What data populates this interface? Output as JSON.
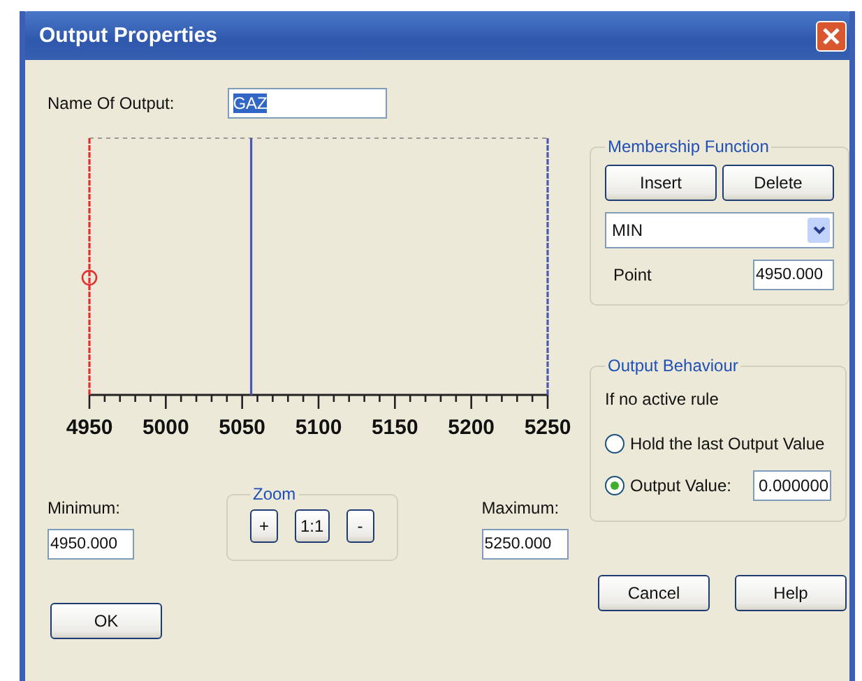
{
  "window": {
    "title": "Output Properties"
  },
  "name_field": {
    "label": "Name Of Output:",
    "value": "GAZ",
    "text_selected": true
  },
  "plot": {
    "axis_labels": [
      "4950",
      "5000",
      "5050",
      "5100",
      "5150",
      "5200",
      "5250"
    ]
  },
  "membership_function": {
    "title": "Membership Function",
    "buttons": [
      "Insert",
      "Delete"
    ],
    "dropdown": {
      "value": "MIN"
    },
    "point": {
      "label": "Point",
      "value": "4950.000"
    }
  },
  "output_behaviour": {
    "title": "Output Behaviour",
    "hint": "If no active rule",
    "options": [
      {
        "label": "Hold the last Output Value",
        "selected": false
      },
      {
        "label": "Output Value:",
        "selected": true,
        "value": "0.000000"
      }
    ]
  },
  "minimum": {
    "label": "Minimum:",
    "value": "4950.000"
  },
  "zoom": {
    "title": "Zoom",
    "buttons": [
      "+",
      "1:1",
      "-"
    ]
  },
  "maximum": {
    "label": "Maximum:",
    "value": "5250.000"
  },
  "buttons": {
    "ok": "OK",
    "cancel": "Cancel",
    "help": "Help"
  }
}
